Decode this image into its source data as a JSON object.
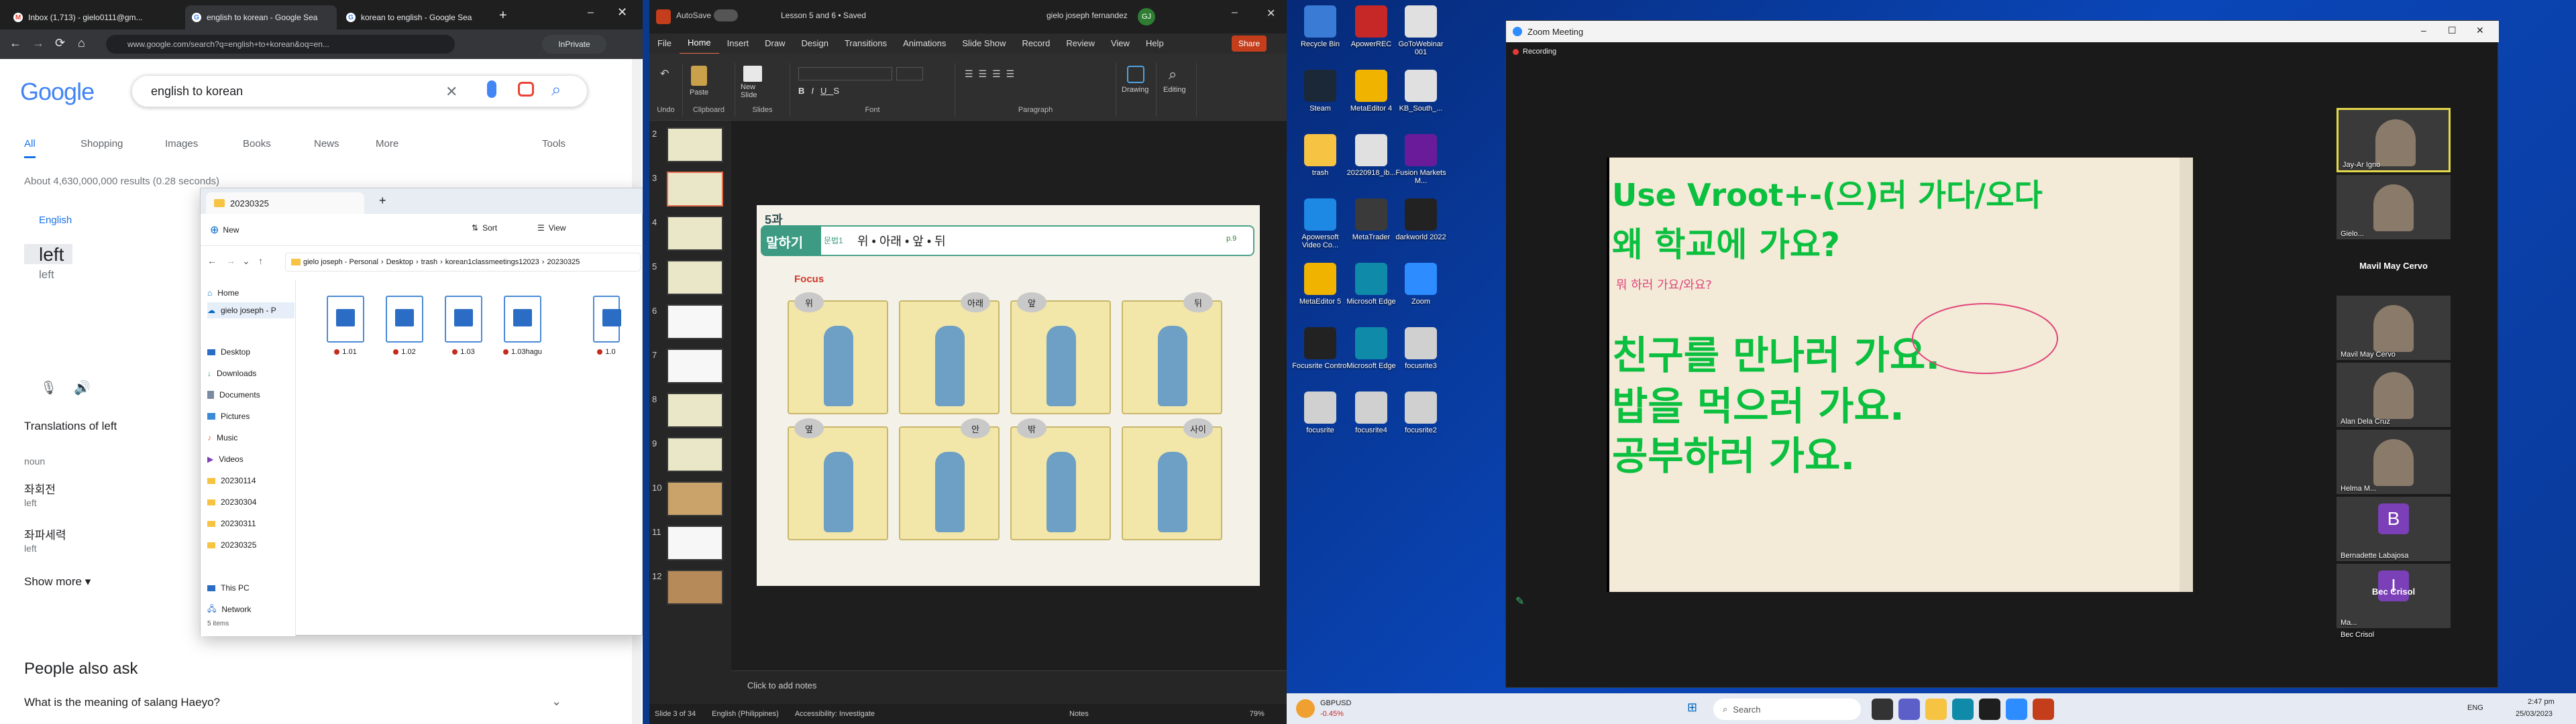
{
  "browser": {
    "tabs": [
      {
        "label": "Inbox (1,713) - gielo0111@gm..."
      },
      {
        "label": "english to korean - Google Sea"
      },
      {
        "label": "korean to english - Google Sea"
      }
    ],
    "url": "www.google.com/search?q=english+to+korean&oq=en...",
    "private_label": "InPrivate",
    "logo": "Google",
    "search_query": "english to korean",
    "search_tabs": [
      "All",
      "Shopping",
      "Images",
      "Books",
      "News",
      "More"
    ],
    "tools_label": "Tools",
    "results_count": "About 4,630,000,000 results (0.28 seconds)",
    "translate": {
      "source_lang": "English",
      "source_word": "left",
      "source_sub": "left"
    },
    "translations_heading": "Translations of left",
    "pos_label": "noun",
    "translations": [
      {
        "word": "좌회전",
        "meaning": "left"
      },
      {
        "word": "좌파세력",
        "meaning": "left"
      }
    ],
    "show_more": "Show more",
    "people_also_ask": "People also ask",
    "paa_q1": "What is the meaning of salang Haeyo?"
  },
  "explorer": {
    "tab_title": "20230325",
    "new_label": "New",
    "sort_label": "Sort",
    "view_label": "View",
    "breadcrumb": [
      "gielo joseph - Personal",
      "Desktop",
      "trash",
      "korean1classmeetings12023",
      "20230325"
    ],
    "nav_items": [
      "Home",
      "gielo joseph - P",
      "Desktop",
      "Downloads",
      "Documents",
      "Pictures",
      "Music",
      "Videos",
      "20230114",
      "20230304",
      "20230311",
      "20230325",
      "This PC",
      "Network"
    ],
    "files": [
      "1.01",
      "1.02",
      "1.03",
      "1.03hagu",
      "1.0"
    ],
    "status": "5 items"
  },
  "powerpoint": {
    "app_title": "AutoSave",
    "doc_title": "Lesson 5 and 6 • Saved",
    "user": "gielo joseph fernandez",
    "share_label": "Share",
    "menu": [
      "File",
      "Home",
      "Insert",
      "Draw",
      "Design",
      "Transitions",
      "Animations",
      "Slide Show",
      "Record",
      "Review",
      "View",
      "Help"
    ],
    "ribbon_groups": [
      "Undo",
      "Clipboard",
      "Slides",
      "Font",
      "Paragraph",
      "Drawing",
      "Editing"
    ],
    "ribbon_buttons": {
      "paste": "Paste",
      "new_slide": "New Slide",
      "drawing": "Drawing",
      "editing": "Editing"
    },
    "slide_numbers": [
      "2",
      "3",
      "4",
      "5",
      "6",
      "7",
      "8",
      "9",
      "10",
      "11",
      "12"
    ],
    "slide": {
      "lesson_badge": "5과",
      "heading": "말하기",
      "subtag": "문법1",
      "title_words": "위 • 아래 • 앞 • 뒤",
      "page_ref": "p.9",
      "focus_label": "Focus",
      "bubbles_top": [
        "위",
        "아래",
        "앞",
        "뒤"
      ],
      "bubbles_bottom": [
        "옆",
        "안",
        "밖",
        "사이"
      ]
    },
    "notes_placeholder": "Click to add notes",
    "status_slide": "Slide 3 of 34",
    "status_lang": "English (Philippines)",
    "status_access": "Accessibility: Investigate",
    "status_notes": "Notes",
    "zoom_pct": "79%"
  },
  "desktop": {
    "icons": [
      {
        "label": "Recycle Bin",
        "color": "#3a7bd5"
      },
      {
        "label": "ApowerREC",
        "color": "#c62828"
      },
      {
        "label": "GoToWebinar 001",
        "color": "#e0e0e0"
      },
      {
        "label": "Steam",
        "color": "#1b2838"
      },
      {
        "label": "MetaEditor 4",
        "color": "#f0b400"
      },
      {
        "label": "KB_South_...",
        "color": "#e0e0e0"
      },
      {
        "label": "trash",
        "color": "#f6c343"
      },
      {
        "label": "20220918_ib...",
        "color": "#e0e0e0"
      },
      {
        "label": "Fusion Markets M...",
        "color": "#6a1b9a"
      },
      {
        "label": "Apowersoft Video Co...",
        "color": "#1e88e5"
      },
      {
        "label": "MetaTrader",
        "color": "#3a3a3a"
      },
      {
        "label": "darkworld 2022",
        "color": "#222"
      },
      {
        "label": "MetaEditor 5",
        "color": "#f0b400"
      },
      {
        "label": "Microsoft Edge",
        "color": "#0f8aa8"
      },
      {
        "label": "Zoom",
        "color": "#2d8cff"
      },
      {
        "label": "Focusrite Control",
        "color": "#222"
      },
      {
        "label": "Microsoft Edge",
        "color": "#0f8aa8"
      },
      {
        "label": "focusrite3",
        "color": "#d0d0d0"
      },
      {
        "label": "focusrite",
        "color": "#d0d0d0"
      },
      {
        "label": "focusrite4",
        "color": "#d0d0d0"
      },
      {
        "label": "focusrite2",
        "color": "#d0d0d0"
      }
    ]
  },
  "zoom": {
    "title": "Zoom Meeting",
    "recording": "Recording",
    "board_lines": [
      "Use Vroot+-(으)러 가다/오다",
      "왜 학교에 가요?",
      "뭐 하러 가요/와요?",
      "친구를 만나러 가요.",
      "밥을 먹으러 가요.",
      "공부하러 가요."
    ],
    "participants": [
      {
        "name": "Jay-Ar Igno"
      },
      {
        "name": "Gielo..."
      },
      {
        "name": "Mavil May Cervo"
      },
      {
        "name": "Mavil May Cervo"
      },
      {
        "name": "Alan Dela Cruz"
      },
      {
        "name": "Helma M..."
      },
      {
        "name": "Bernadette Labajosa",
        "initial": "B",
        "color": "#7b3fb8"
      },
      {
        "name": "Ma...",
        "initial": "I",
        "color": "#7b3fb8"
      },
      {
        "name": "Bec Crisol"
      },
      {
        "name": "Bec Crisol"
      }
    ]
  },
  "taskbar": {
    "ticker_symbol": "GBPUSD",
    "ticker_change": "-0.45%",
    "search_label": "Search",
    "lang": "ENG",
    "time": "2:47 pm",
    "date": "25/03/2023"
  }
}
